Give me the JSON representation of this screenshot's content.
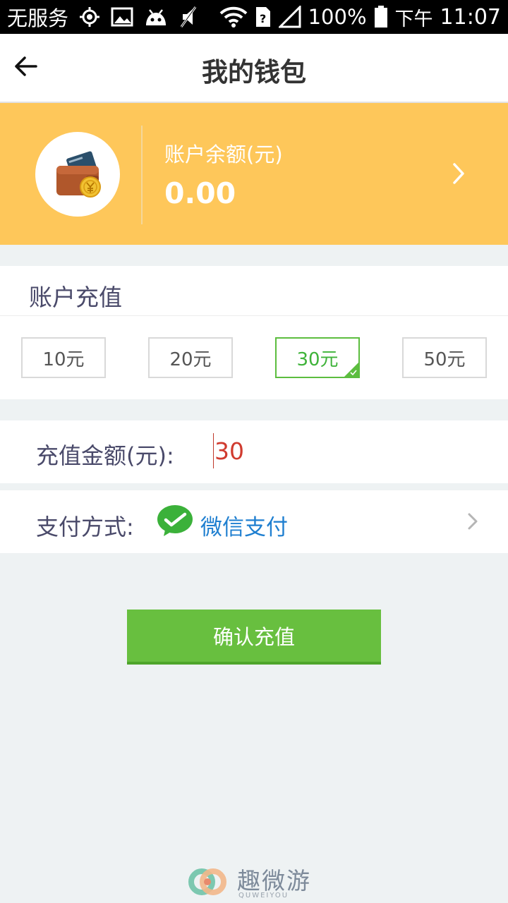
{
  "status_bar": {
    "carrier": "无服务",
    "battery": "100%",
    "ampm": "下午",
    "time": "11:07",
    "icons": [
      "location-icon",
      "image-icon",
      "android-icon",
      "no-sound-icon",
      "wifi-icon",
      "sim-icon",
      "signal-icon",
      "battery-icon"
    ]
  },
  "header": {
    "title": "我的钱包",
    "back_icon": "arrow-left-icon"
  },
  "balance": {
    "label": "账户余额(元)",
    "amount": "0.00",
    "wallet_icon": "wallet-icon",
    "arrow_icon": "chevron-right-icon",
    "background_color": "#fec75a"
  },
  "recharge": {
    "title": "账户充值",
    "options": [
      {
        "label": "10元",
        "selected": false
      },
      {
        "label": "20元",
        "selected": false
      },
      {
        "label": "30元",
        "selected": true
      },
      {
        "label": "50元",
        "selected": false
      }
    ],
    "selected_color": "#5cbd3f"
  },
  "amount": {
    "label": "充值金额(元):",
    "value": "30",
    "value_color": "#d03b2f"
  },
  "payment": {
    "label": "支付方式:",
    "method": "微信支付",
    "method_icon": "wechat-icon",
    "arrow_icon": "chevron-right-icon",
    "method_color": "#1f7fd0"
  },
  "confirm": {
    "label": "确认充值",
    "color": "#68bf3f"
  },
  "brand": {
    "name": "趣微游",
    "subtitle": "QUWEIYOU"
  }
}
